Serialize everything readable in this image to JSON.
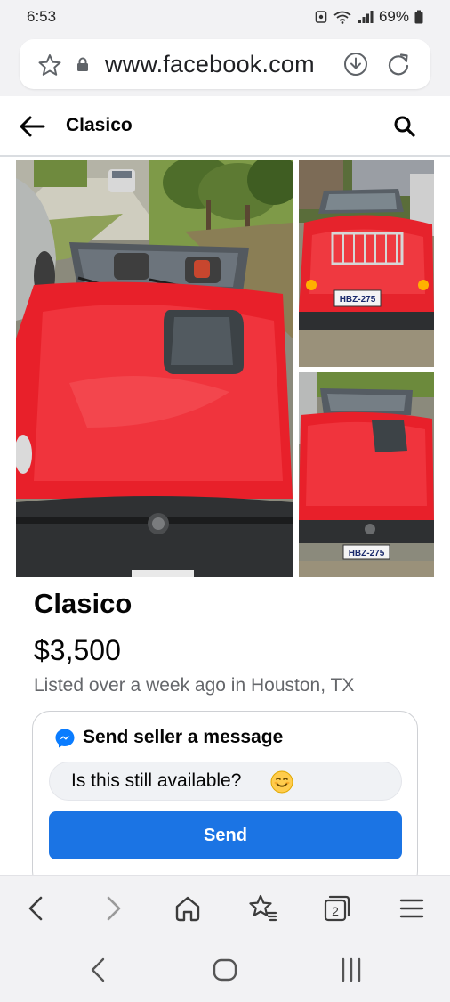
{
  "status_bar": {
    "time": "6:53",
    "battery": "69%"
  },
  "browser": {
    "url": "www.facebook.com",
    "tab_count": "2"
  },
  "header": {
    "title": "Clasico"
  },
  "listing": {
    "title": "Clasico",
    "price": "$3,500",
    "meta": "Listed over a week ago in Houston, TX",
    "photo_plate": "HBZ-275"
  },
  "message_card": {
    "heading": "Send seller a message",
    "input_value": "Is this still available?",
    "send_label": "Send"
  },
  "colors": {
    "fb_blue": "#1b74e4",
    "car_red": "#e8202a",
    "messenger": "#0a7cff"
  }
}
